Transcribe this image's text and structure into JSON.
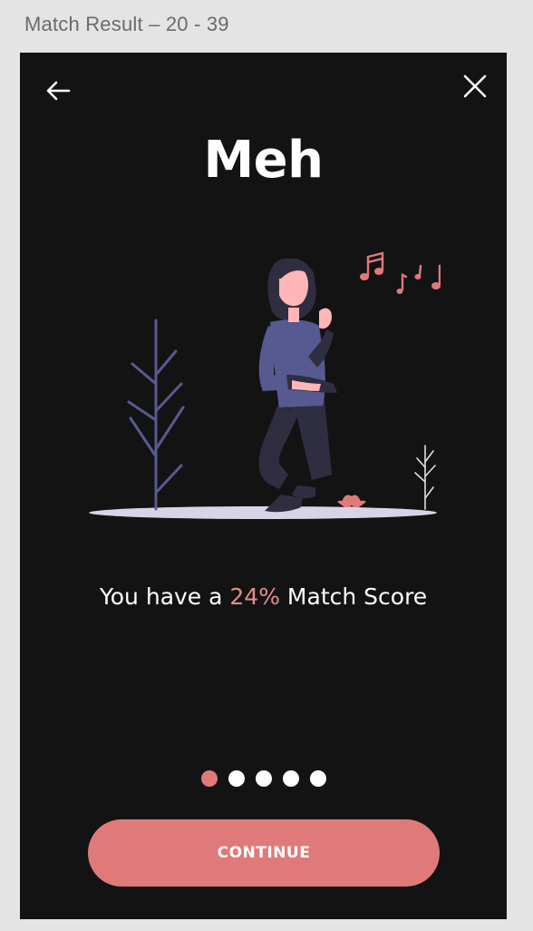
{
  "artboard": {
    "label": "Match Result – 20 - 39"
  },
  "header": {
    "title": "Meh"
  },
  "result": {
    "prefix": "You have a ",
    "percent": "24%",
    "suffix": " Match Score"
  },
  "pagination": {
    "total": 5,
    "active_index": 0
  },
  "actions": {
    "continue_label": "CONTINUE"
  },
  "colors": {
    "accent": "#e07a7a",
    "background": "#141314",
    "figure_top": "#575a91",
    "figure_pants": "#2f2e41",
    "ground": "#d8d4e8"
  },
  "icons": {
    "back": "arrow-left-icon",
    "close": "close-icon"
  }
}
